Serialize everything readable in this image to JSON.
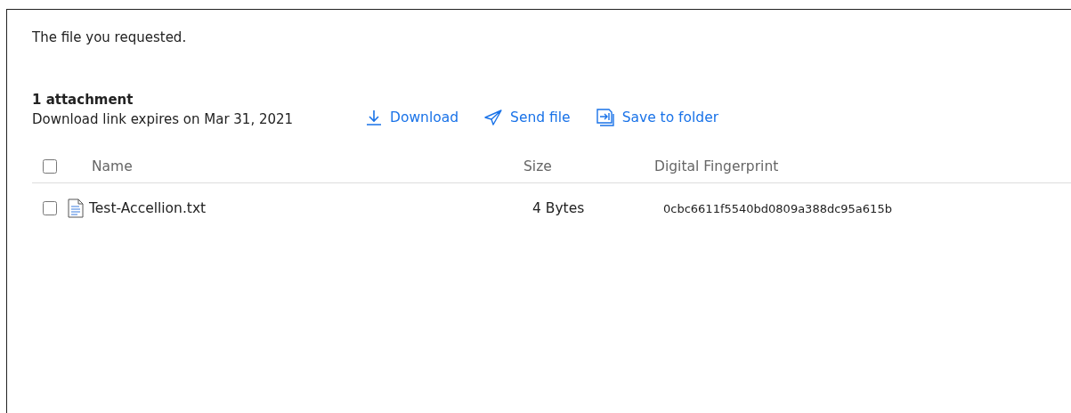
{
  "message": "The file you requested.",
  "attachments": {
    "title": "1 attachment",
    "expiry": "Download link expires on Mar 31, 2021",
    "actions": [
      {
        "kind": "download",
        "label": "Download"
      },
      {
        "kind": "send",
        "label": "Send file"
      },
      {
        "kind": "save",
        "label": "Save to folder"
      }
    ]
  },
  "table": {
    "select_all": {
      "checked": false
    },
    "columns": [
      "Name",
      "Size",
      "Digital Fingerprint"
    ],
    "rows": [
      {
        "checked": false,
        "name": "Test-Accellion.txt",
        "size": "4 Bytes",
        "fingerprint": "0cbc6611f5540bd0809a388dc95a615b"
      }
    ]
  }
}
